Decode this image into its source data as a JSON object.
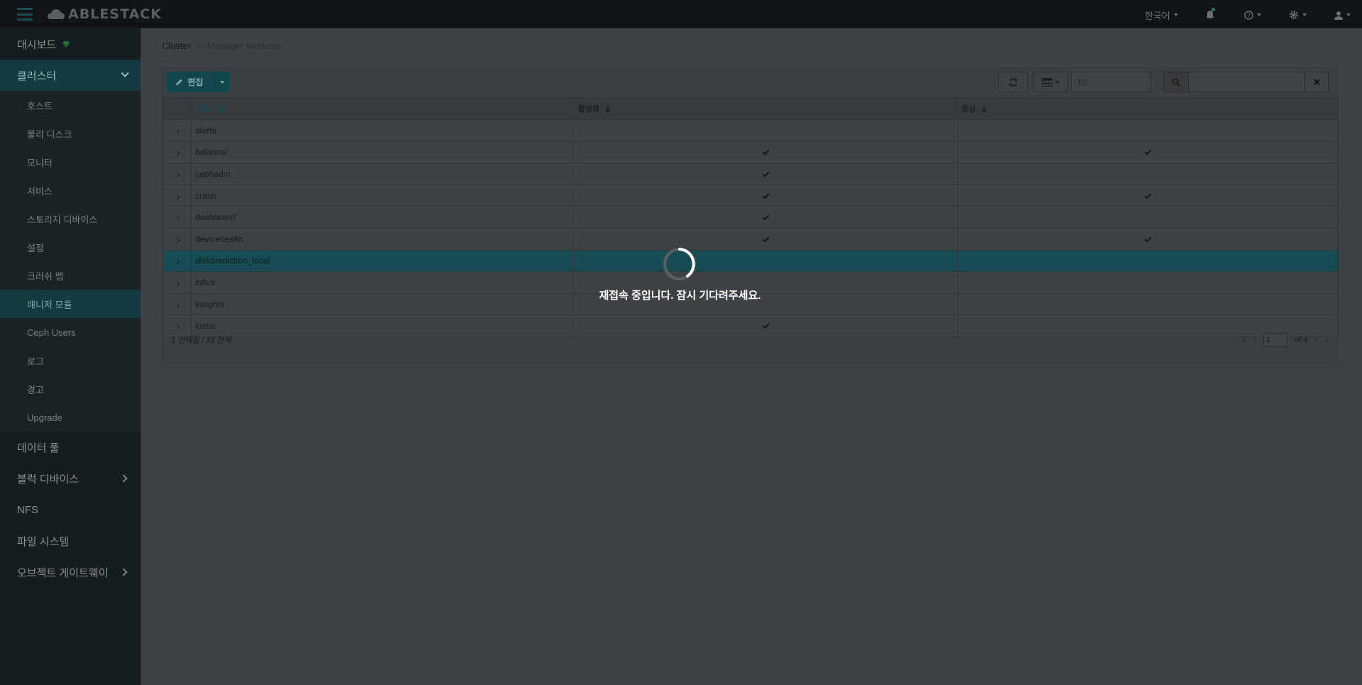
{
  "app": {
    "brand": "ABLESTACK"
  },
  "navbar": {
    "language": "한국어",
    "icons": [
      "bell-icon",
      "help-icon",
      "gear-icon",
      "user-icon"
    ]
  },
  "sidebar": {
    "dashboard": "대시보드",
    "cluster": {
      "label": "클러스터",
      "items": [
        "호스트",
        "물리 디스크",
        "모니터",
        "서비스",
        "스토리지 디바이스",
        "설정",
        "크러쉬 맵",
        "매니저 모듈",
        "Ceph Users",
        "로그",
        "경고",
        "Upgrade"
      ]
    },
    "pools": "데이터 풀",
    "block": "블럭 디바이스",
    "nfs": "NFS",
    "filesystem": "파일 시스템",
    "object_gateway": "오브젝트 게이트웨이"
  },
  "breadcrumb": {
    "parent": "Cluster",
    "current": "Manager Modules"
  },
  "toolbar": {
    "edit_label": "편집",
    "page_size": "10"
  },
  "table": {
    "columns": {
      "name": "이름",
      "enabled": "활성화",
      "always_on": "항상"
    },
    "rows": [
      {
        "name": "alerts",
        "enabled": false,
        "always": false
      },
      {
        "name": "balancer",
        "enabled": true,
        "always": true
      },
      {
        "name": "cephadm",
        "enabled": true,
        "always": false
      },
      {
        "name": "crash",
        "enabled": true,
        "always": true
      },
      {
        "name": "dashboard",
        "enabled": true,
        "always": false
      },
      {
        "name": "devicehealth",
        "enabled": true,
        "always": true
      },
      {
        "name": "diskprediction_local",
        "enabled": false,
        "always": false,
        "selected": true
      },
      {
        "name": "influx",
        "enabled": false,
        "always": false
      },
      {
        "name": "insights",
        "enabled": false,
        "always": false
      },
      {
        "name": "iostat",
        "enabled": true,
        "always": false
      }
    ]
  },
  "footer": {
    "selection_text": "1 선택됨 / 33 전체",
    "page": "1",
    "of_pages": "of 4"
  },
  "overlay": {
    "message": "재접속 중입니다. 잠시 기다려주세요."
  },
  "colors": {
    "accent": "#11464d",
    "selected_row": "#164c53",
    "sidebar": "#161d21",
    "navbar": "#101416"
  }
}
